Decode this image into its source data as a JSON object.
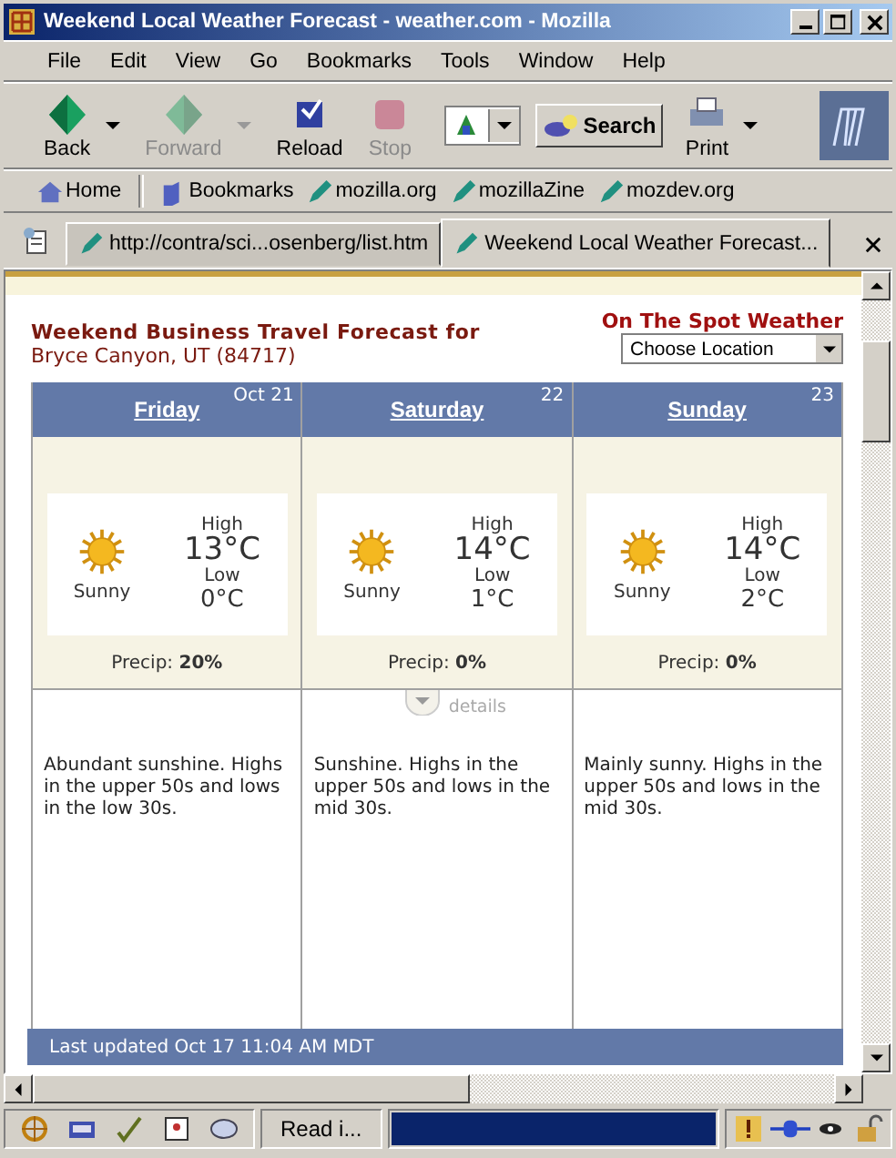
{
  "window": {
    "title": "Weekend Local Weather Forecast - weather.com - Mozilla"
  },
  "menu": [
    "File",
    "Edit",
    "View",
    "Go",
    "Bookmarks",
    "Tools",
    "Window",
    "Help"
  ],
  "toolbar": [
    {
      "kind": "back",
      "label": "Back",
      "disabled": false
    },
    {
      "kind": "forward",
      "label": "Forward",
      "disabled": true
    },
    {
      "kind": "reload",
      "label": "Reload",
      "disabled": false
    },
    {
      "kind": "stop",
      "label": "Stop",
      "disabled": true
    }
  ],
  "search_button": "Search",
  "print_button": "Print",
  "bookmarks": [
    {
      "kind": "home",
      "label": "Home"
    },
    {
      "kind": "folder",
      "label": "Bookmarks"
    },
    {
      "kind": "link",
      "label": "mozilla.org"
    },
    {
      "kind": "link",
      "label": "mozillaZine"
    },
    {
      "kind": "link",
      "label": "mozdev.org"
    }
  ],
  "tabs": [
    {
      "label": "http://contra/sci...osenberg/list.htm",
      "selected": false
    },
    {
      "label": "Weekend Local Weather Forecast...",
      "selected": true
    }
  ],
  "page": {
    "heading": "Weekend Business Travel Forecast for",
    "location": "Bryce Canyon, UT (84717)",
    "spot_title": "On The Spot Weather",
    "location_select": "Choose Location",
    "days": [
      {
        "name": "Friday",
        "date": "Oct 21",
        "condition": "Sunny",
        "high_label": "High",
        "high": "13°C",
        "low_label": "Low",
        "low": "0°C",
        "precip": "Precip: **20%**",
        "description": "Abundant sunshine. Highs in the upper 50s and lows in the low 30s."
      },
      {
        "name": "Saturday",
        "date": "22",
        "condition": "Sunny",
        "high_label": "High",
        "high": "14°C",
        "low_label": "Low",
        "low": "1°C",
        "precip": "Precip: **0%**",
        "description": "Sunshine. Highs in the upper 50s and lows in the mid 30s."
      },
      {
        "name": "Sunday",
        "date": "23",
        "condition": "Sunny",
        "high_label": "High",
        "high": "14°C",
        "low_label": "Low",
        "low": "2°C",
        "precip": "Precip: **0%**",
        "description": "Mainly sunny. Highs in the upper 50s and lows in the mid 30s."
      }
    ],
    "details_label": "details",
    "footer": "Last updated Oct 17 11:04 AM MDT"
  },
  "status": {
    "text": "Read i...",
    "progress": {
      "level": 1
    }
  }
}
